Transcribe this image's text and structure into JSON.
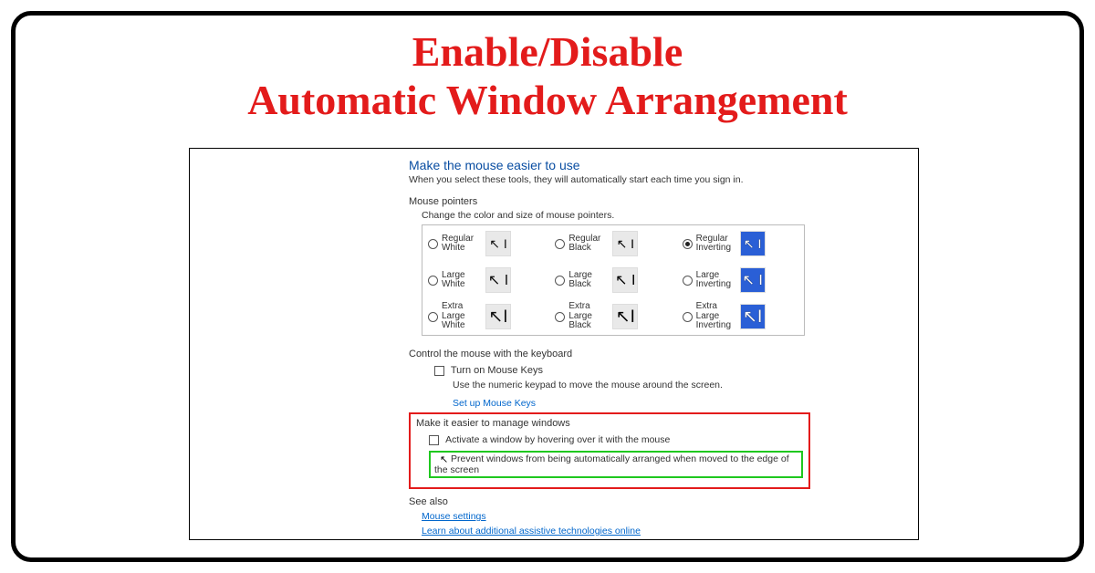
{
  "headline": {
    "line1": "Enable/Disable",
    "line2": "Automatic Window Arrangement"
  },
  "panel": {
    "title": "Make the mouse easier to use",
    "subtitle": "When you select these tools, they will automatically start each time you sign in.",
    "section_pointers": "Mouse pointers",
    "pointers_caption": "Change the color and size of mouse pointers.",
    "options": {
      "row1": {
        "a": "Regular White",
        "b": "Regular Black",
        "c": "Regular Inverting"
      },
      "row2": {
        "a": "Large White",
        "b": "Large Black",
        "c": "Large Inverting"
      },
      "row3": {
        "a": "Extra Large White",
        "b": "Extra Large Black",
        "c": "Extra Large Inverting"
      }
    },
    "selected": "Regular Inverting",
    "section_keyboard": "Control the mouse with the keyboard",
    "mousekeys_label": "Turn on Mouse Keys",
    "mousekeys_desc": "Use the numeric keypad to move the mouse around the screen.",
    "setup_link": "Set up Mouse Keys",
    "section_manage": "Make it easier to manage windows",
    "activate_label": "Activate a window by hovering over it with the mouse",
    "prevent_label": "Prevent windows from being automatically arranged when moved to the edge of the screen",
    "see_also": "See also",
    "link_mouse_settings": "Mouse settings",
    "link_assistive": "Learn about additional assistive technologies online"
  }
}
